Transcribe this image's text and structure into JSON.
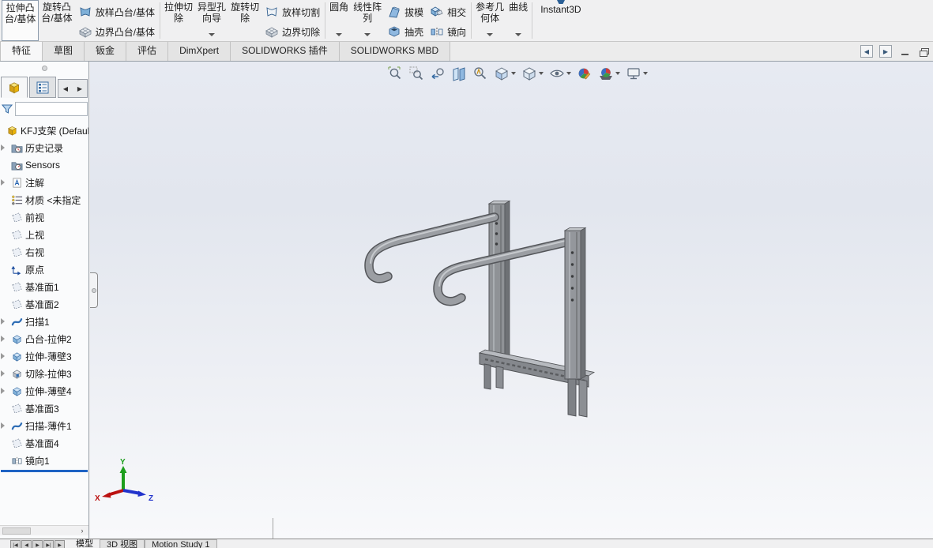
{
  "ribbon": {
    "g1b1": "拉伸凸\n台/基体",
    "g1b2": "旋转凸\n台/基体",
    "g1b3": "放样凸台/基体",
    "g1b4": "边界凸台/基体",
    "g2b1": "拉伸切\n除",
    "g2b2": "异型孔\n向导",
    "g2b3": "旋转切\n除",
    "g2b4": "放样切割",
    "g2b5": "边界切除",
    "g3b1": "圆角",
    "g3b2": "线性阵\n列",
    "g3b3": "拔模",
    "g3b4": "抽壳",
    "g3b5": "相交",
    "g3b6": "镜向",
    "g4b1": "参考几\n何体",
    "g4b2": "曲线",
    "g5b1": "Instant3D"
  },
  "command_tabs": {
    "t1": "特征",
    "t2": "草图",
    "t3": "钣金",
    "t4": "评估",
    "t5": "DimXpert",
    "t6": "SOLIDWORKS 插件",
    "t7": "SOLIDWORKS MBD"
  },
  "panel_scroll": {
    "right_arrow": "›"
  },
  "tree": {
    "items": [
      {
        "label": "KFJ支架  (Default"
      },
      {
        "label": "历史记录"
      },
      {
        "label": "Sensors"
      },
      {
        "label": "注解"
      },
      {
        "label": "材质 <未指定"
      },
      {
        "label": "前视"
      },
      {
        "label": "上视"
      },
      {
        "label": "右视"
      },
      {
        "label": "原点"
      },
      {
        "label": "基准面1"
      },
      {
        "label": "基准面2"
      },
      {
        "label": "扫描1"
      },
      {
        "label": "凸台-拉伸2"
      },
      {
        "label": "拉伸-薄壁3"
      },
      {
        "label": "切除-拉伸3"
      },
      {
        "label": "拉伸-薄壁4"
      },
      {
        "label": "基准面3"
      },
      {
        "label": "扫描-薄件1"
      },
      {
        "label": "基准面4"
      },
      {
        "label": "镜向1"
      }
    ]
  },
  "triad": {
    "x": "X",
    "y": "Y",
    "z": "Z"
  },
  "bottom": {
    "tab_model": "模型",
    "tab_3d": "3D 视图",
    "tab_motion": "Motion Study 1",
    "nav1": "|◀",
    "nav2": "◀",
    "nav3": "▶",
    "nav4": "▶|",
    "nav5": "▶"
  },
  "colors": {
    "accent_blue": "#1e63c4",
    "model_gray": "#909399",
    "viewport_top": "#e7eaf2",
    "viewport_bottom": "#f8f9fb",
    "triad_x": "#cc2222",
    "triad_y": "#1d9e1d",
    "triad_z": "#2233cc"
  }
}
